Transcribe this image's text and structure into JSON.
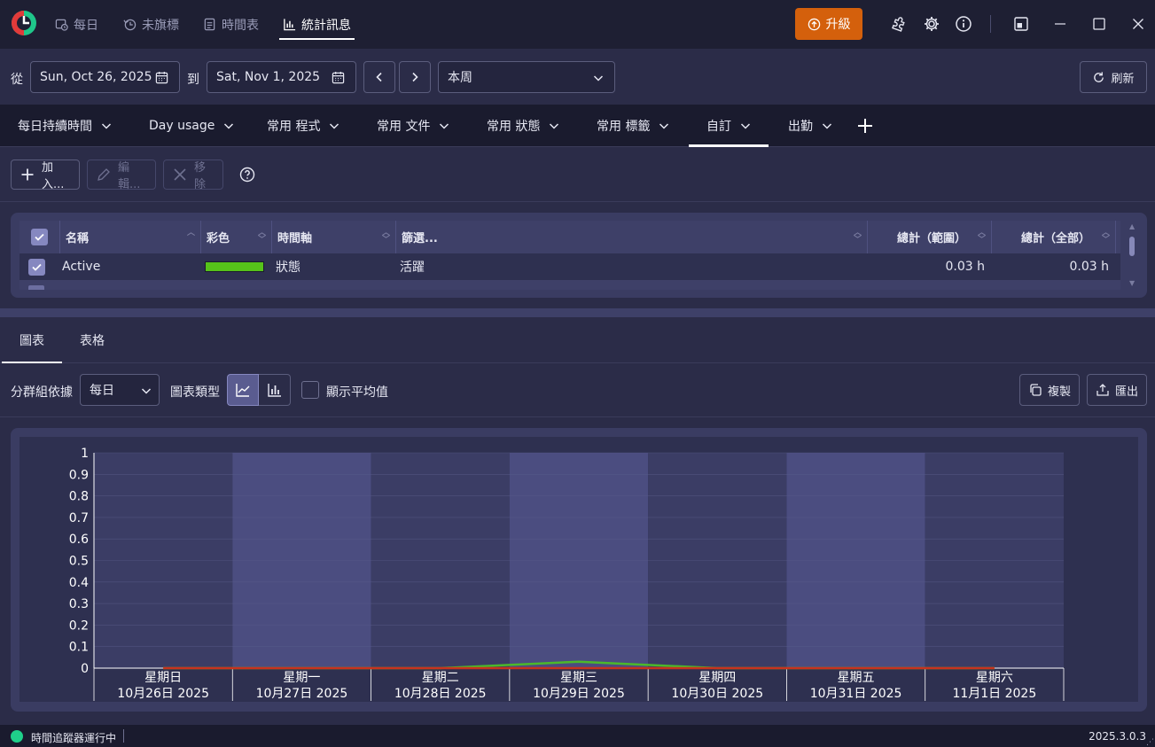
{
  "titlebar": {
    "nav": [
      {
        "label": "每日",
        "icon": "calendar-clock-icon"
      },
      {
        "label": "未旗標",
        "icon": "history-icon"
      },
      {
        "label": "時間表",
        "icon": "timesheet-icon"
      },
      {
        "label": "統計訊息",
        "icon": "bar-chart-icon",
        "active": true
      }
    ],
    "upgrade_label": "升級"
  },
  "daterange": {
    "from_label": "從",
    "from_value": "Sun, Oct 26, 2025",
    "to_label": "到",
    "to_value": "Sat, Nov 1, 2025",
    "period_value": "本周",
    "refresh_label": "刷新"
  },
  "report_tabs": [
    {
      "label": "每日持續時間"
    },
    {
      "label": "Day usage"
    },
    {
      "label": "常用 程式"
    },
    {
      "label": "常用 文件"
    },
    {
      "label": "常用 狀態"
    },
    {
      "label": "常用 標籤"
    },
    {
      "label": "自訂",
      "active": true
    },
    {
      "label": "出勤"
    }
  ],
  "toolbar": {
    "add_label": "加入...",
    "edit_label": "編輯...",
    "remove_label": "移除"
  },
  "grid": {
    "headers": [
      "名稱",
      "彩色",
      "時間軸",
      "篩選...",
      "總計（範圍）",
      "總計（全部）"
    ],
    "rows": [
      {
        "checked": true,
        "name": "Active",
        "color": "#56c21a",
        "timeline": "狀態",
        "filter": "活躍",
        "total_range": "0.03 h",
        "total_all": "0.03 h"
      }
    ]
  },
  "view_tabs": [
    {
      "label": "圖表",
      "active": true
    },
    {
      "label": "表格"
    }
  ],
  "chart_controls": {
    "group_by_label": "分群組依據",
    "group_by_value": "每日",
    "chart_type_label": "圖表類型",
    "show_average_label": "顯示平均值",
    "copy_label": "複製",
    "export_label": "匯出"
  },
  "chart_data": {
    "type": "line",
    "categories": [
      [
        "星期日",
        "10月26日 2025"
      ],
      [
        "星期一",
        "10月27日 2025"
      ],
      [
        "星期二",
        "10月28日 2025"
      ],
      [
        "星期三",
        "10月29日 2025"
      ],
      [
        "星期四",
        "10月30日 2025"
      ],
      [
        "星期五",
        "10月31日 2025"
      ],
      [
        "星期六",
        "11月1日 2025"
      ]
    ],
    "ylim": [
      0,
      1
    ],
    "yticks": [
      "1",
      "0.9",
      "0.8",
      "0.7",
      "0.6",
      "0.5",
      "0.4",
      "0.3",
      "0.2",
      "0.1",
      "0"
    ],
    "series": [
      {
        "values": [
          0,
          0,
          0,
          0.03,
          0,
          0,
          0
        ],
        "color": "#4cb82a"
      },
      {
        "values": [
          0,
          0,
          0,
          0,
          0,
          0,
          0
        ],
        "color": "#c8321e"
      }
    ],
    "grid": true
  },
  "statusbar": {
    "status_text": "時間追蹤器運行中",
    "status_color": "#1fd08a",
    "version": "2025.3.0.3"
  }
}
